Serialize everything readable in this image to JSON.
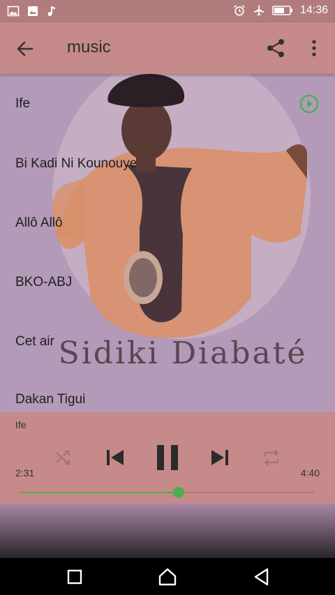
{
  "status_bar": {
    "left_icons": [
      "image-icon",
      "photo-icon",
      "music-note-icon"
    ],
    "right_icons": [
      "alarm-icon",
      "airplane-mode-icon",
      "battery-icon"
    ],
    "time": "14:36"
  },
  "app_bar": {
    "title": "music",
    "icons": [
      "back-arrow-icon",
      "share-icon",
      "more-vert-icon"
    ]
  },
  "artwork": {
    "artist_name": "Sidiki Diabaté"
  },
  "playlist": {
    "songs": [
      "Ife",
      "Bi Kadi Ni Kounouye",
      "Allô Allô",
      "BKO-ABJ",
      "Cet air",
      "Dakan Tigui"
    ],
    "active_index": 0
  },
  "player": {
    "now_playing": "Ife",
    "current_time": "2:31",
    "total_time": "4:40",
    "progress": 0.54,
    "controls": [
      "shuffle-icon",
      "previous-icon",
      "pause-icon",
      "next-icon",
      "repeat-icon"
    ]
  },
  "colors": {
    "accent": "#4caf50",
    "app_bar": "#c58a89",
    "content_bg": "#b39ab8"
  },
  "nav_bar": {
    "icons": [
      "recent-apps-icon",
      "home-icon",
      "back-icon"
    ]
  }
}
